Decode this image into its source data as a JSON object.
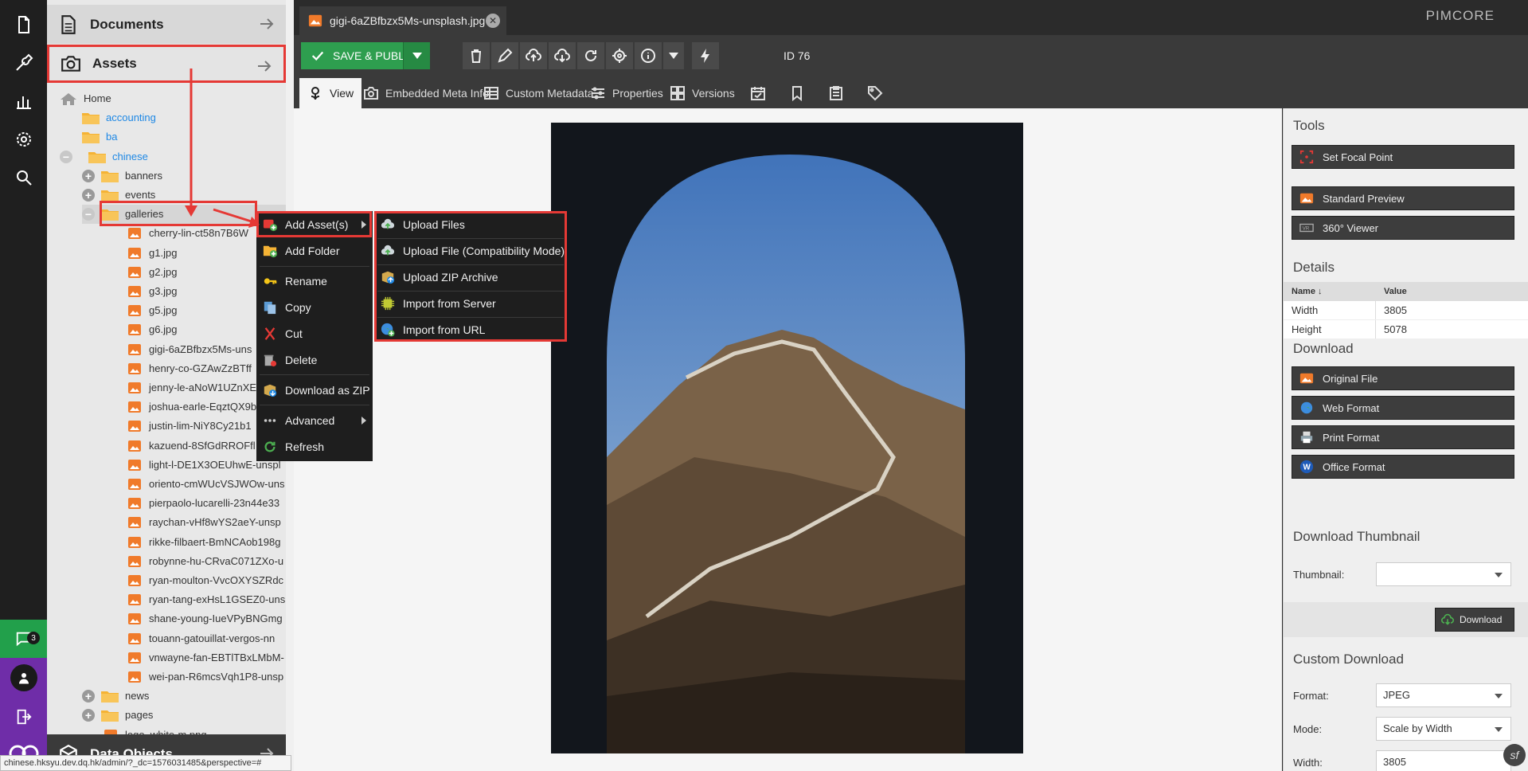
{
  "left_nav": {
    "items": [
      "file-icon",
      "wrench-icon",
      "chart-icon",
      "gear-icon",
      "search-icon"
    ],
    "chat_badge": "3"
  },
  "accordion": {
    "documents": "Documents",
    "assets": "Assets",
    "data_objects": "Data Objects"
  },
  "tree": {
    "home": "Home",
    "folders_top": [
      "accounting",
      "ba",
      "chinese"
    ],
    "chinese_children": [
      "banners",
      "events",
      "galleries"
    ],
    "gallery_files": [
      "cherry-lin-ct58n7B6W",
      "g1.jpg",
      "g2.jpg",
      "g3.jpg",
      "g5.jpg",
      "g6.jpg",
      "gigi-6aZBfbzx5Ms-uns",
      "henry-co-GZAwZzBTff",
      "jenny-le-aNoW1UZnXE",
      "joshua-earle-EqztQX9b",
      "justin-lim-NiY8Cy21b1",
      "kazuend-8SfGdRROFfl",
      "light-l-DE1X3OEUhwE-unspl",
      "oriento-cmWUcVSJWOw-uns",
      "pierpaolo-lucarelli-23n44e33",
      "raychan-vHf8wYS2aeY-unsp",
      "rikke-filbaert-BmNCAob198g",
      "robynne-hu-CRvaC071ZXo-u",
      "ryan-moulton-VvcOXYSZRdc",
      "ryan-tang-exHsL1GSEZ0-uns",
      "shane-young-IueVPyBNGmg",
      "touann-gatouillat-vergos-nn",
      "vnwayne-fan-EBTlTBxLMbM-",
      "wei-pan-R6mcsVqh1P8-unsp"
    ],
    "after": [
      "news",
      "pages",
      "logo_white-m.png"
    ]
  },
  "tab": {
    "title": "gigi-6aZBfbzx5Ms-unsplash.jpg"
  },
  "brand": "PIMCORE",
  "toolbar": {
    "save_label": "SAVE & PUBLISH",
    "id_label": "ID 76"
  },
  "subtabs": [
    "View",
    "Embedded Meta Info",
    "Custom Metadata",
    "Properties",
    "Versions"
  ],
  "context_menu": {
    "items": [
      "Add Asset(s)",
      "Add Folder",
      "Rename",
      "Copy",
      "Cut",
      "Delete",
      "Download as ZIP",
      "Advanced",
      "Refresh"
    ]
  },
  "submenu": {
    "items": [
      "Upload Files",
      "Upload File (Compatibility Mode)",
      "Upload ZIP Archive",
      "Import from Server",
      "Import from URL"
    ]
  },
  "panel": {
    "tools_title": "Tools",
    "set_focal_point": "Set Focal Point",
    "standard_preview": "Standard Preview",
    "viewer_360": "360° Viewer",
    "details_title": "Details",
    "col_name": "Name",
    "col_value": "Value",
    "rows": [
      {
        "name": "Width",
        "value": "3805"
      },
      {
        "name": "Height",
        "value": "5078"
      }
    ],
    "download_title": "Download",
    "original_file": "Original File",
    "web_format": "Web Format",
    "print_format": "Print Format",
    "office_format": "Office Format",
    "thumb_title": "Download Thumbnail",
    "thumb_label": "Thumbnail:",
    "thumb_value": "",
    "download_btn": "Download",
    "custom_title": "Custom Download",
    "format_label": "Format:",
    "format_value": "JPEG",
    "mode_label": "Mode:",
    "mode_value": "Scale by Width",
    "width_label": "Width:",
    "width_value": "3805"
  },
  "status_url": "chinese.hksyu.dev.dq.hk/admin/?_dc=1576031485&perspective=#",
  "colors": {
    "accent_green": "#2e9e4f",
    "highlight_red": "#e53935",
    "folder": "#f5b335",
    "image": "#f07a2a",
    "purple": "#6f2da8"
  }
}
